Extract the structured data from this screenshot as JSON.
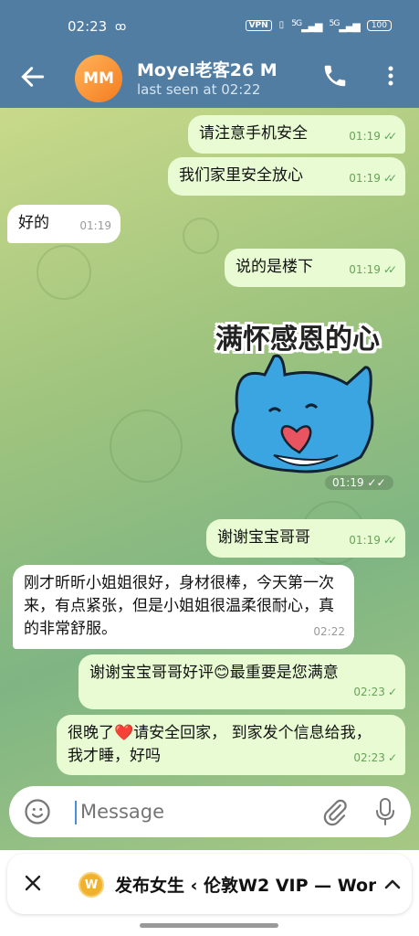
{
  "status_bar": {
    "time": "02:23",
    "vpn": "VPN",
    "network1": "5G",
    "network2": "5G",
    "battery": "100"
  },
  "header": {
    "avatar_initials": "MM",
    "title": "Moyel老客26 M",
    "subtitle": "last seen at 02:22"
  },
  "messages": [
    {
      "text": "请注意手机安全",
      "time": "01:19",
      "dir": "out"
    },
    {
      "text": "我们家里安全放心",
      "time": "01:19",
      "dir": "out"
    },
    {
      "text": "好的",
      "time": "01:19",
      "dir": "in"
    },
    {
      "text": "说的是楼下",
      "time": "01:19",
      "dir": "out"
    },
    {
      "text": "谢谢宝宝哥哥",
      "time": "01:19",
      "dir": "out"
    },
    {
      "text": "刚才昕昕小姐姐很好，身材很棒，今天第一次来，有点紧张，但是小姐姐很温柔很耐心，真的非常舒服。",
      "time": "02:22",
      "dir": "in"
    },
    {
      "text": "谢谢宝宝哥哥好评😊最重要是您满意",
      "time": "02:23",
      "dir": "out"
    },
    {
      "text": "很晚了❤️请安全回家， 到家发个信息给我， 我才睡，好吗",
      "time": "02:23",
      "dir": "out"
    }
  ],
  "sticker": {
    "caption": "满怀感恩的心",
    "time": "01:19"
  },
  "input": {
    "placeholder": "Message"
  },
  "pinned": {
    "logo": "W",
    "text": "发布女生 ‹ 伦敦W2 VIP — Wor"
  },
  "colors": {
    "header": "#527da3",
    "outgoing_bubble": "#e8fbd3",
    "incoming_bubble": "#ffffff",
    "accent": "#4a8fd4"
  }
}
